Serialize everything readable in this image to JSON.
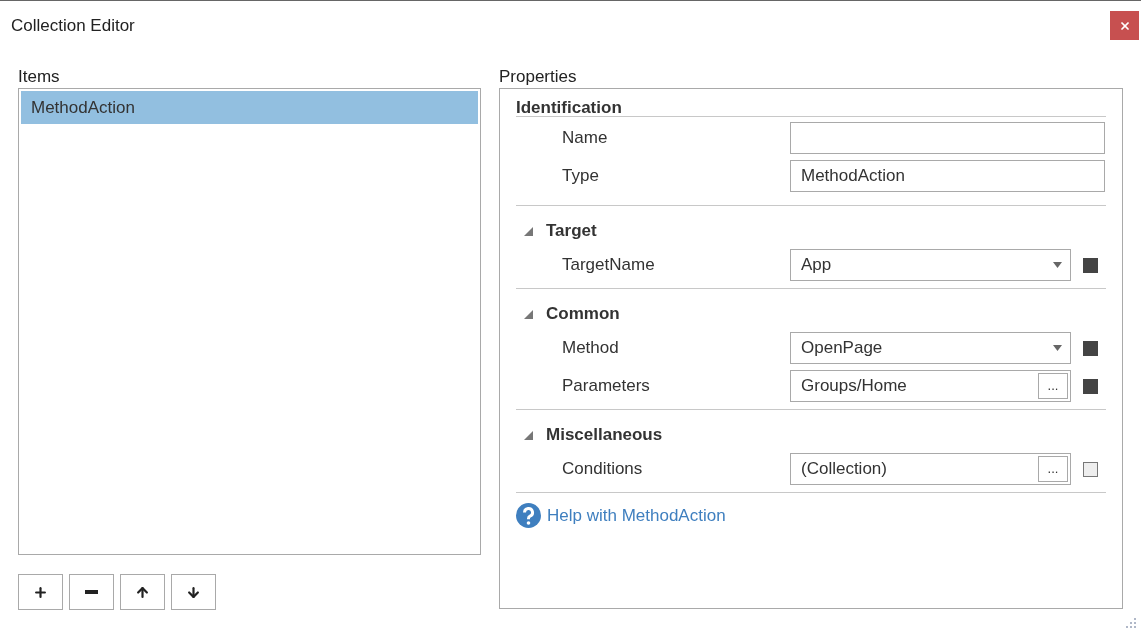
{
  "window": {
    "title": "Collection Editor"
  },
  "items_panel": {
    "label": "Items",
    "items": [
      {
        "label": "MethodAction",
        "selected": true
      }
    ]
  },
  "properties_panel": {
    "label": "Properties",
    "identification": {
      "title": "Identification",
      "rows": [
        {
          "label": "Name",
          "kind": "text",
          "value": ""
        },
        {
          "label": "Type",
          "kind": "text",
          "value": "MethodAction"
        }
      ]
    },
    "categories": [
      {
        "title": "Target",
        "expanded": true,
        "rows": [
          {
            "label": "TargetName",
            "kind": "dropdown",
            "value": "App",
            "set": true
          }
        ]
      },
      {
        "title": "Common",
        "expanded": true,
        "rows": [
          {
            "label": "Method",
            "kind": "dropdown",
            "value": "OpenPage",
            "set": true
          },
          {
            "label": "Parameters",
            "kind": "ellipsis",
            "value": "Groups/Home",
            "button": "...",
            "set": true
          }
        ]
      },
      {
        "title": "Miscellaneous",
        "expanded": true,
        "rows": [
          {
            "label": "Conditions",
            "kind": "ellipsis",
            "value": "(Collection)",
            "button": "...",
            "set": false
          }
        ]
      }
    ],
    "help_link": "Help with MethodAction"
  }
}
